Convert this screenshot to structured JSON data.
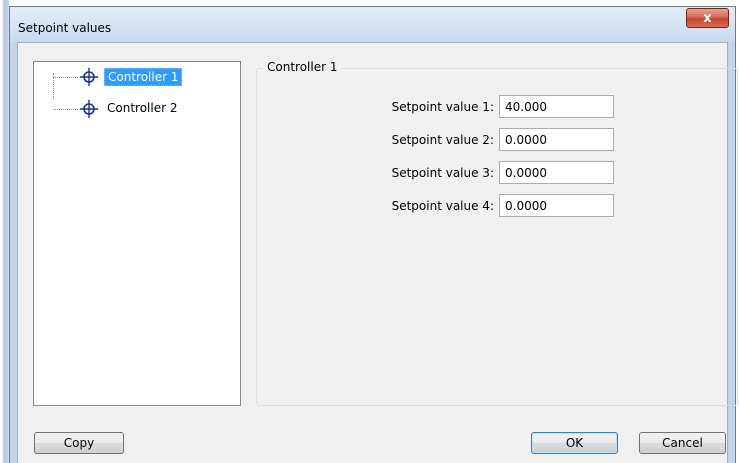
{
  "window": {
    "title": "Setpoint values",
    "close_glyph": "x"
  },
  "tree": {
    "items": [
      {
        "label": "Controller 1",
        "icon": "target-icon",
        "selected": true
      },
      {
        "label": "Controller 2",
        "icon": "target-icon",
        "selected": false
      }
    ]
  },
  "panel": {
    "legend": "Controller 1",
    "fields": [
      {
        "label": "Setpoint value 1:",
        "value": "40.000"
      },
      {
        "label": "Setpoint value 2:",
        "value": "0.0000"
      },
      {
        "label": "Setpoint value 3:",
        "value": "0.0000"
      },
      {
        "label": "Setpoint value 4:",
        "value": "0.0000"
      }
    ]
  },
  "buttons": {
    "copy": "Copy",
    "ok": "OK",
    "cancel": "Cancel"
  },
  "colors": {
    "selection": "#3399ff",
    "close_button": "#c4482f"
  }
}
